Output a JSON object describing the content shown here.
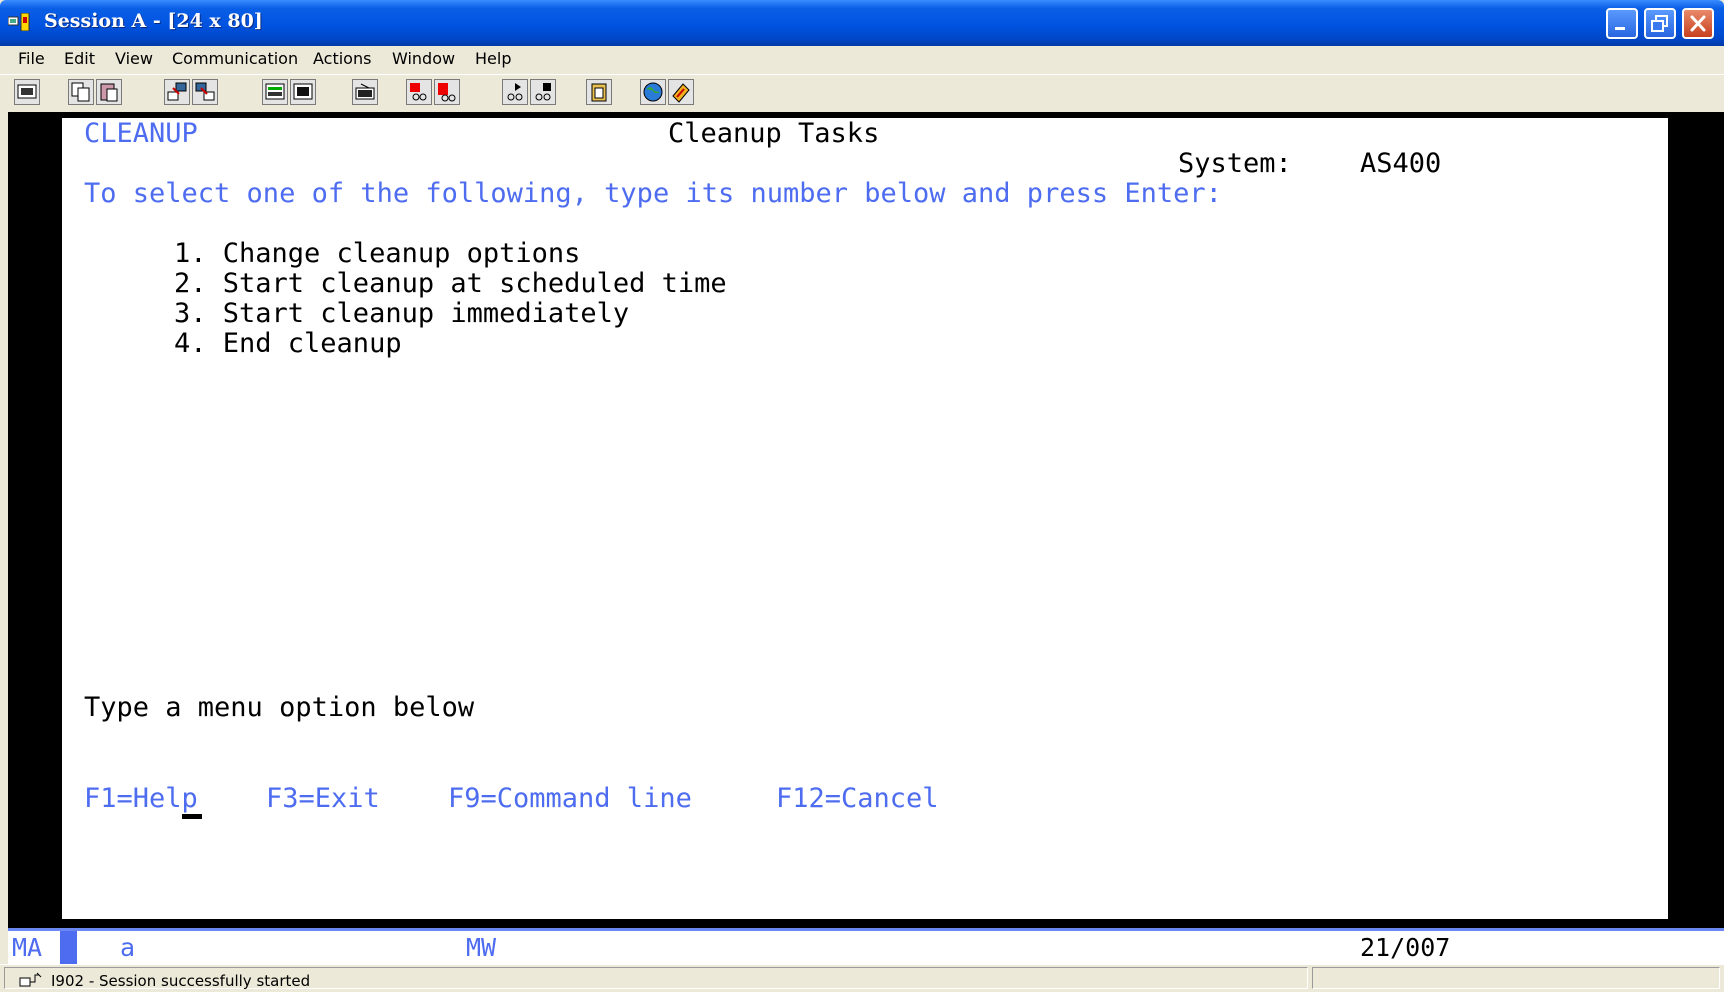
{
  "window": {
    "title": "Session A - [24 x 80]",
    "icons": [
      "app-icon",
      "minimize-icon",
      "restore-icon",
      "close-icon"
    ]
  },
  "menubar": {
    "items": [
      "File",
      "Edit",
      "View",
      "Communication",
      "Actions",
      "Window",
      "Help"
    ]
  },
  "toolbar": {
    "buttons": [
      "print-screen",
      "copy",
      "paste",
      "send",
      "receive",
      "display-keypad",
      "macro",
      "record-macro",
      "stop-macro",
      "play-macro",
      "playback",
      "clipboard",
      "web",
      "help"
    ]
  },
  "screen": {
    "menu_id": "CLEANUP",
    "title": "Cleanup Tasks",
    "system_label": "System:",
    "system_name": "AS400",
    "instruction": "To select one of the following, type its number below and press Enter:",
    "options": [
      "1. Change cleanup options",
      "2. Start cleanup at scheduled time",
      "3. Start cleanup immediately",
      "4. End cleanup"
    ],
    "prompt": "Type a menu option below",
    "function_keys": [
      "F1=Help",
      "F3=Exit",
      "F9=Command line",
      "F12=Cancel"
    ],
    "colors": {
      "field_text": "#4D6CF0",
      "text": "#000000",
      "background": "#FFFFFF"
    }
  },
  "oia": {
    "mode": "MA",
    "shift": "a",
    "message_wait": "MW",
    "cursor_position": "21/007"
  },
  "statusbar": {
    "message": "I902 - Session successfully started"
  }
}
